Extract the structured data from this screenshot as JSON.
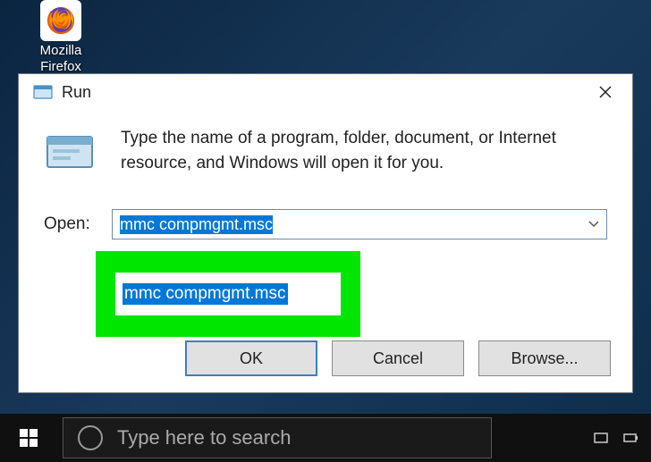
{
  "desktop": {
    "icons": [
      {
        "name": "mozilla-firefox",
        "label": "Mozilla\nFirefox"
      }
    ]
  },
  "run_dialog": {
    "title": "Run",
    "description": "Type the name of a program, folder, document, or Internet resource, and Windows will open it for you.",
    "open_label": "Open:",
    "open_value": "mmc compmgmt.msc",
    "buttons": {
      "ok": "OK",
      "cancel": "Cancel",
      "browse": "Browse..."
    }
  },
  "taskbar": {
    "search_placeholder": "Type here to search"
  }
}
